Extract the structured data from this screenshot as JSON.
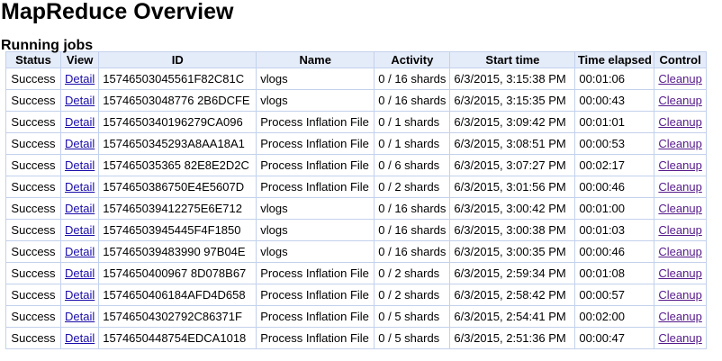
{
  "page": {
    "title": "MapReduce Overview"
  },
  "running_jobs": {
    "heading": "Running jobs",
    "columns": [
      "Status",
      "View",
      "ID",
      "Name",
      "Activity",
      "Start time",
      "Time elapsed",
      "Control"
    ],
    "rows": [
      {
        "status": "Success",
        "view": "Detail",
        "id": "15746503045561F82C81C",
        "name": "vlogs",
        "activity": "0 / 16 shards",
        "start": "6/3/2015, 3:15:38 PM",
        "elapsed": "00:01:06",
        "control": "Cleanup"
      },
      {
        "status": "Success",
        "view": "Detail",
        "id": "15746503048776 2B6DCFE",
        "name": "vlogs",
        "activity": "0 / 16 shards",
        "start": "6/3/2015, 3:15:35 PM",
        "elapsed": "00:00:43",
        "control": "Cleanup"
      },
      {
        "status": "Success",
        "view": "Detail",
        "id": "1574650340196279CA096",
        "name": "Process Inflation File",
        "activity": "0 / 1 shards",
        "start": "6/3/2015, 3:09:42 PM",
        "elapsed": "00:01:01",
        "control": "Cleanup"
      },
      {
        "status": "Success",
        "view": "Detail",
        "id": "1574650345293A8AA18A1",
        "name": "Process Inflation File",
        "activity": "0 / 1 shards",
        "start": "6/3/2015, 3:08:51 PM",
        "elapsed": "00:00:53",
        "control": "Cleanup"
      },
      {
        "status": "Success",
        "view": "Detail",
        "id": "157465035365 82E8E2D2C",
        "name": "Process Inflation File",
        "activity": "0 / 6 shards",
        "start": "6/3/2015, 3:07:27 PM",
        "elapsed": "00:02:17",
        "control": "Cleanup"
      },
      {
        "status": "Success",
        "view": "Detail",
        "id": "1574650386750E4E5607D",
        "name": "Process Inflation File",
        "activity": "0 / 2 shards",
        "start": "6/3/2015, 3:01:56 PM",
        "elapsed": "00:00:46",
        "control": "Cleanup"
      },
      {
        "status": "Success",
        "view": "Detail",
        "id": "157465039412275E6E712",
        "name": "vlogs",
        "activity": "0 / 16 shards",
        "start": "6/3/2015, 3:00:42 PM",
        "elapsed": "00:01:00",
        "control": "Cleanup"
      },
      {
        "status": "Success",
        "view": "Detail",
        "id": "15746503945445F4F1850",
        "name": "vlogs",
        "activity": "0 / 16 shards",
        "start": "6/3/2015, 3:00:38 PM",
        "elapsed": "00:01:03",
        "control": "Cleanup"
      },
      {
        "status": "Success",
        "view": "Detail",
        "id": "157465039483990 97B04E",
        "name": "vlogs",
        "activity": "0 / 16 shards",
        "start": "6/3/2015, 3:00:35 PM",
        "elapsed": "00:00:46",
        "control": "Cleanup"
      },
      {
        "status": "Success",
        "view": "Detail",
        "id": "1574650400967 8D078B67",
        "name": "Process Inflation File",
        "activity": "0 / 2 shards",
        "start": "6/3/2015, 2:59:34 PM",
        "elapsed": "00:01:08",
        "control": "Cleanup"
      },
      {
        "status": "Success",
        "view": "Detail",
        "id": "1574650406184AFD4D658",
        "name": "Process Inflation File",
        "activity": "0 / 2 shards",
        "start": "6/3/2015, 2:58:42 PM",
        "elapsed": "00:00:57",
        "control": "Cleanup"
      },
      {
        "status": "Success",
        "view": "Detail",
        "id": "15746504302792C86371F",
        "name": "Process Inflation File",
        "activity": "0 / 5 shards",
        "start": "6/3/2015, 2:54:41 PM",
        "elapsed": "00:02:00",
        "control": "Cleanup"
      },
      {
        "status": "Success",
        "view": "Detail",
        "id": "1574650448754EDCA1018",
        "name": "Process Inflation File",
        "activity": "0 / 5 shards",
        "start": "6/3/2015, 2:51:36 PM",
        "elapsed": "00:00:47",
        "control": "Cleanup"
      }
    ]
  },
  "colors": {
    "header_bg": "#e5ecf9",
    "border": "#c3d1ec",
    "link": "#1a0dab",
    "visited_link": "#551a8b"
  }
}
